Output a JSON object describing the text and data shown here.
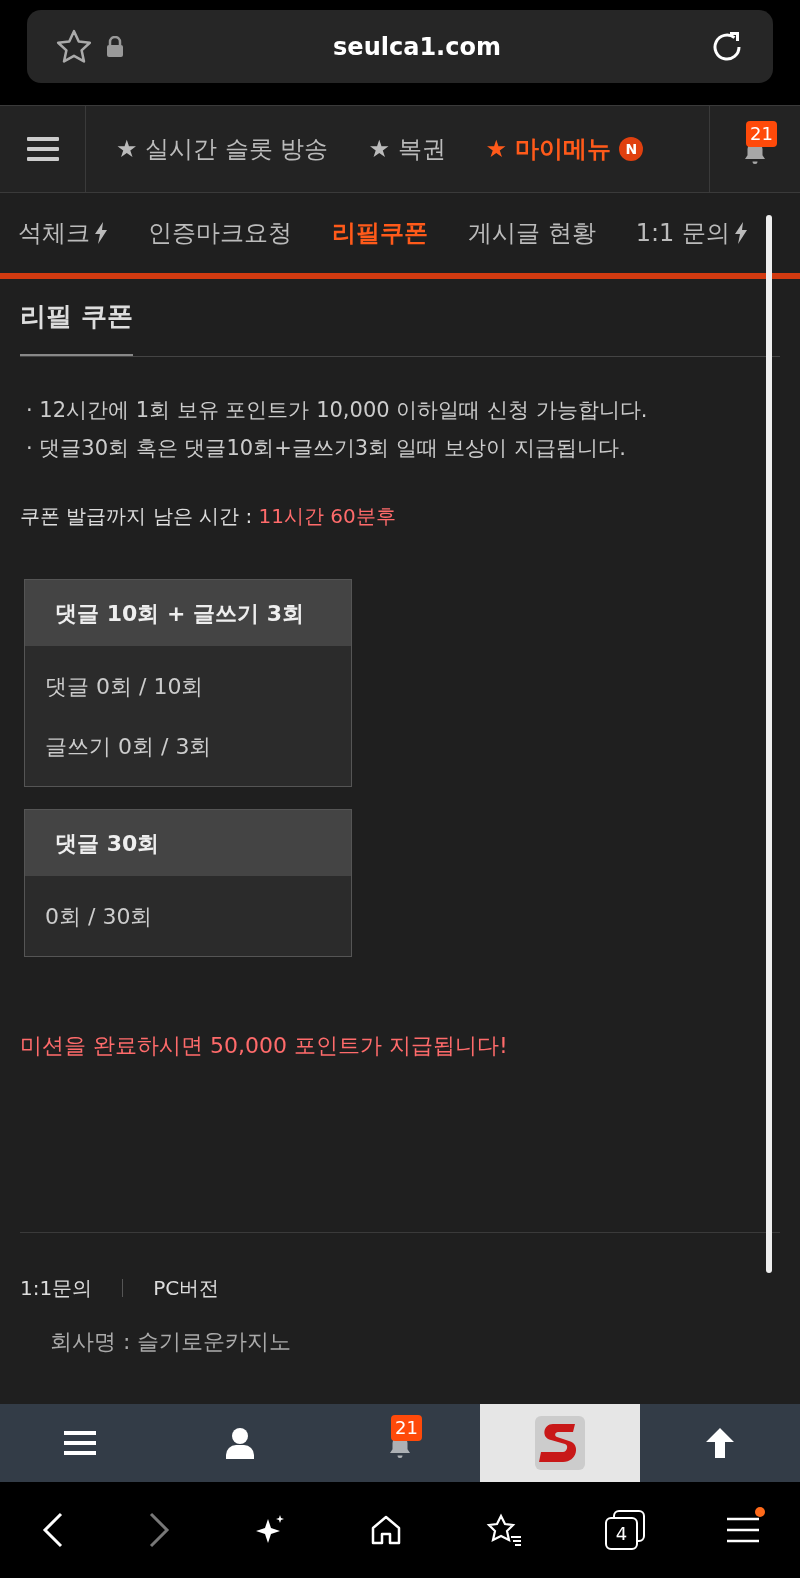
{
  "browser": {
    "url": "seulca1.com"
  },
  "header": {
    "links": [
      {
        "label": "★ 실시간 슬롯 방송",
        "selected": false
      },
      {
        "label": "★ 복권",
        "selected": false
      },
      {
        "label": "★ 마이메뉴",
        "selected": true,
        "badge": "N"
      }
    ],
    "notification_count": "21"
  },
  "subnav": [
    {
      "label": "석체크",
      "selected": false,
      "bolt": true
    },
    {
      "label": "인증마크요청",
      "selected": false,
      "bolt": false
    },
    {
      "label": "리필쿠폰",
      "selected": true,
      "bolt": false
    },
    {
      "label": "게시글 현황",
      "selected": false,
      "bolt": false
    },
    {
      "label": "1:1 문의",
      "selected": false,
      "bolt": true
    }
  ],
  "page": {
    "title": "리필 쿠폰",
    "notes": [
      "· 12시간에 1회 보유 포인트가 10,000 이하일때 신청 가능합니다.",
      "· 댓글30회 혹은 댓글10회+글쓰기3회 일때 보상이 지급됩니다."
    ],
    "timer_label": "쿠폰 발급까지 남은 시간 :",
    "timer_value": "11시간 60분후",
    "missions": [
      {
        "title": "댓글 10회 + 글쓰기 3회",
        "lines": [
          "댓글 0회 / 10회",
          "글쓰기 0회 / 3회"
        ]
      },
      {
        "title": "댓글 30회",
        "lines": [
          "0회 / 30회"
        ]
      }
    ],
    "reward": "미션을 완료하시면 50,000 포인트가 지급됩니다!"
  },
  "footer": {
    "links": [
      "1:1문의",
      "PC버전"
    ],
    "company": "회사명 : 슬기로운카지노"
  },
  "bottom_nav": {
    "notification_count": "21"
  },
  "browser_bar": {
    "tab_count": "4"
  }
}
